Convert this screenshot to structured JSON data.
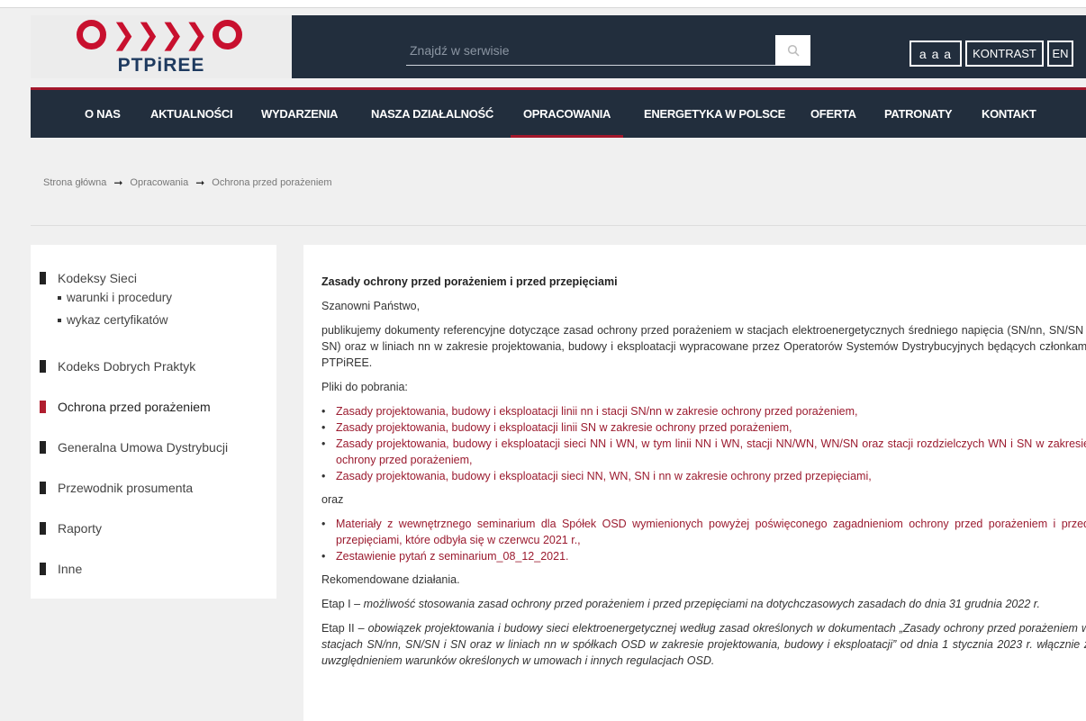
{
  "logo": {
    "text": "PTPiREE"
  },
  "header": {
    "search_placeholder": "Znajdź w serwisie",
    "font_size_label": "a a a",
    "contrast_label": "KONTRAST",
    "lang_label": "EN"
  },
  "nav": {
    "items": [
      {
        "label": "O NAS"
      },
      {
        "label": "AKTUALNOŚCI"
      },
      {
        "label": "WYDARZENIA"
      },
      {
        "label": "NASZA DZIAŁALNOŚĆ"
      },
      {
        "label": "OPRACOWANIA"
      },
      {
        "label": "ENERGETYKA W POLSCE"
      },
      {
        "label": "OFERTA"
      },
      {
        "label": "PATRONATY"
      },
      {
        "label": "KONTAKT"
      }
    ],
    "active": "OPRACOWANIA"
  },
  "breadcrumb": {
    "items": [
      "Strona główna",
      "Opracowania",
      "Ochrona przed porażeniem"
    ],
    "separator": "➞"
  },
  "sidebar": {
    "items": [
      {
        "label": "Kodeksy Sieci"
      },
      {
        "label": "Kodeks Dobrych Praktyk"
      },
      {
        "label": "Ochrona przed porażeniem"
      },
      {
        "label": "Generalna Umowa Dystrybucji"
      },
      {
        "label": "Przewodnik prosumenta"
      },
      {
        "label": "Raporty"
      },
      {
        "label": "Inne"
      }
    ],
    "subitems": [
      "warunki i procedury",
      "wykaz certyfikatów"
    ],
    "active": "Ochrona przed porażeniem"
  },
  "content": {
    "title": "Zasady ochrony przed porażeniem i przed przepięciami",
    "greeting": "Szanowni Państwo,",
    "intro": "publikujemy dokumenty referencyjne dotyczące zasad ochrony przed porażeniem w stacjach elektroenergetycznych średniego napięcia (SN/nn, SN/SN i SN) oraz w liniach nn w zakresie projektowania, budowy i eksploatacji wypracowane przez Operatorów Systemów Dystrybucyjnych będących członkami PTPiREE.",
    "downloads_label": "Pliki do pobrania:",
    "links": [
      "Zasady projektowania, budowy i eksploatacji linii nn i stacji SN/nn w zakresie ochrony przed porażeniem,",
      "Zasady projektowania, budowy i eksploatacji linii SN w zakresie ochrony przed porażeniem,",
      "Zasady projektowania, budowy i eksploatacji sieci NN i WN, w tym linii NN i WN, stacji NN/WN, WN/SN oraz stacji rozdzielczych WN i SN w zakresie ochrony przed porażeniem,",
      "Zasady projektowania, budowy i eksploatacji sieci NN, WN, SN i nn w zakresie ochrony przed przepięciami,"
    ],
    "oraz": "oraz",
    "links2": [
      "Materiały z wewnętrznego seminarium dla Spółek OSD wymienionych powyżej poświęconego zagadnieniom ochrony przed porażeniem i przed przepięciami, które odbyła się w czerwcu 2021 r.,",
      "Zestawienie pytań z seminarium_08_12_2021."
    ],
    "recommended": "Rekomendowane działania.",
    "stage1_label": "Etap I –",
    "stage1_text": "możliwość stosowania zasad ochrony przed porażeniem i przed przepięciami na dotychczasowych zasadach do dnia 31 grudnia 2022 r.",
    "stage2_label": "Etap II –",
    "stage2_text": "obowiązek projektowania i budowy sieci elektroenergetycznej według zasad określonych w dokumentach „Zasady ochrony przed porażeniem w stacjach SN/nn, SN/SN i SN oraz w liniach nn w spółkach OSD w zakresie projektowania, budowy i eksploatacji” od dnia 1 stycznia 2023 r. włącznie z uwzględnieniem warunków określonych w umowach i innych regulacjach OSD."
  },
  "colors": {
    "brand_red": "#c8102e",
    "nav_bg": "#222e3d",
    "link": "#9b1b2f"
  }
}
